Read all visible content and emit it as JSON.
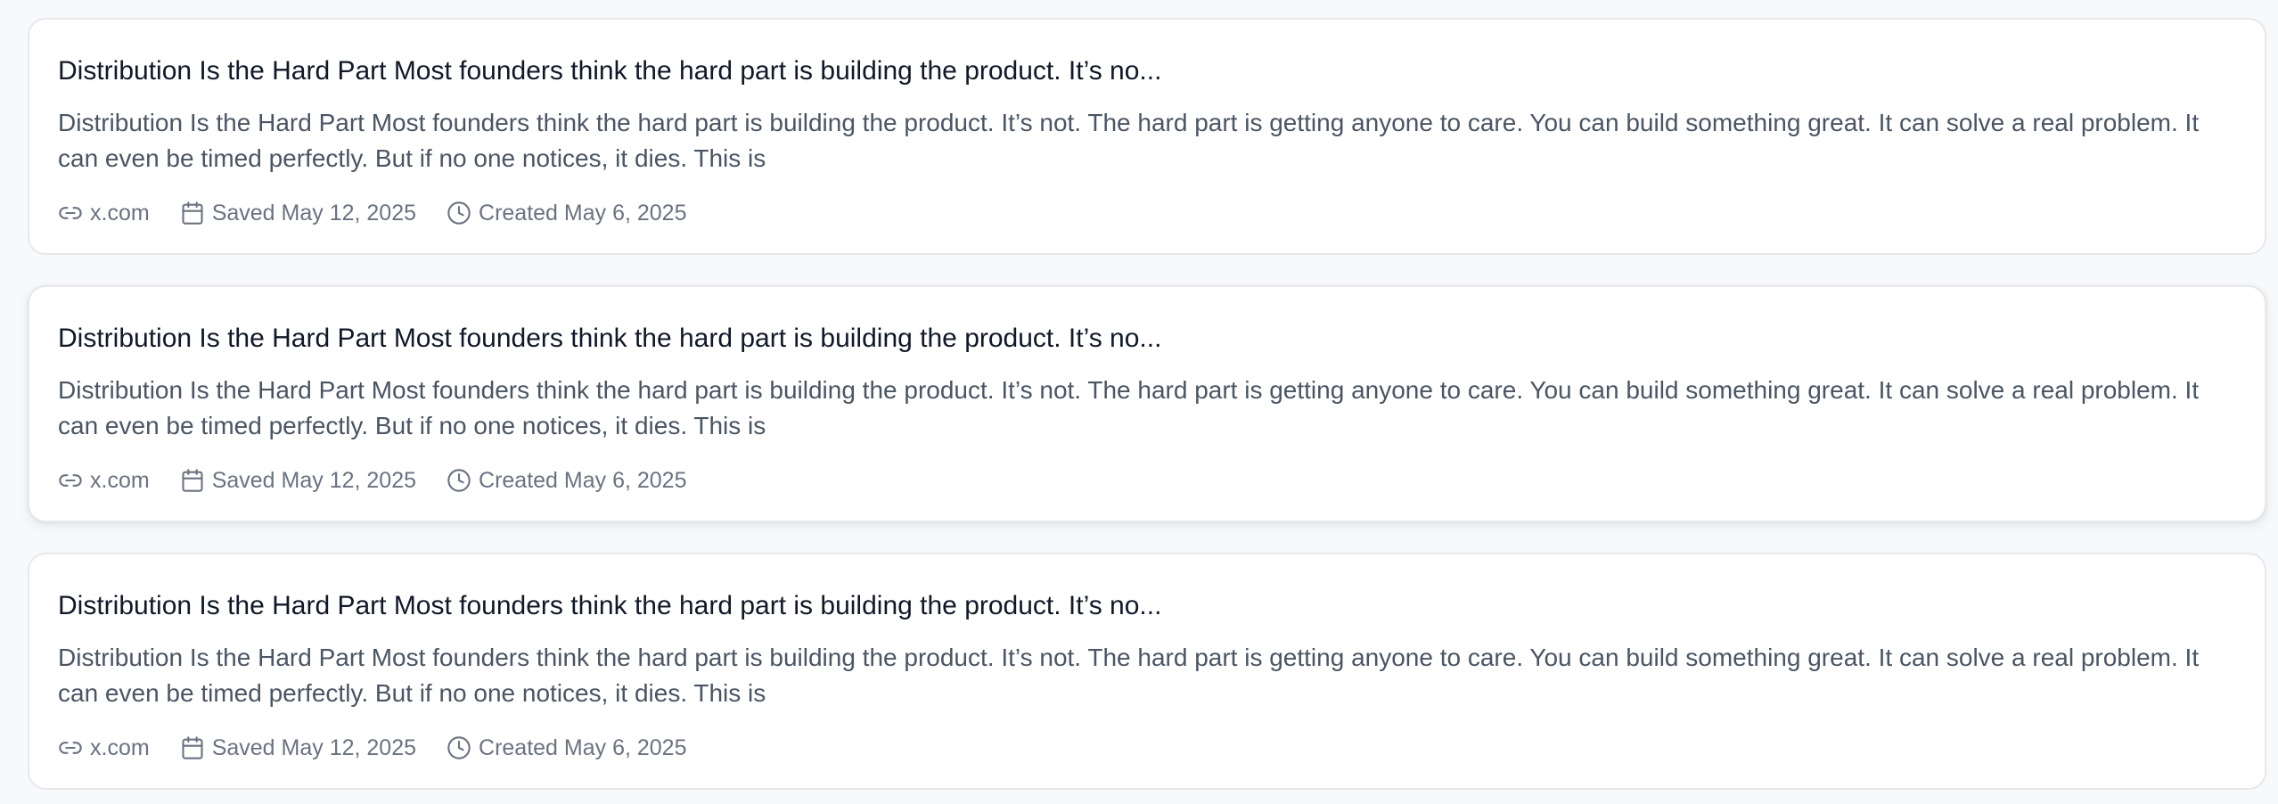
{
  "cards": [
    {
      "title": "Distribution Is the Hard Part Most founders think the hard part is building the product. It’s no...",
      "excerpt": "Distribution Is the Hard Part Most founders think the hard part is building the product. It’s not. The hard part is getting anyone to care. You can build something great. It can solve a real problem. It can even be timed perfectly. But if no one notices, it dies. This is",
      "source": "x.com",
      "saved": "Saved May 12, 2025",
      "created": "Created May 6, 2025"
    },
    {
      "title": "Distribution Is the Hard Part Most founders think the hard part is building the product. It’s no...",
      "excerpt": "Distribution Is the Hard Part Most founders think the hard part is building the product. It’s not. The hard part is getting anyone to care. You can build something great. It can solve a real problem. It can even be timed perfectly. But if no one notices, it dies. This is",
      "source": "x.com",
      "saved": "Saved May 12, 2025",
      "created": "Created May 6, 2025"
    },
    {
      "title": "Distribution Is the Hard Part Most founders think the hard part is building the product. It’s no...",
      "excerpt": "Distribution Is the Hard Part Most founders think the hard part is building the product. It’s not. The hard part is getting anyone to care. You can build something great. It can solve a real problem. It can even be timed perfectly. But if no one notices, it dies. This is",
      "source": "x.com",
      "saved": "Saved May 12, 2025",
      "created": "Created May 6, 2025"
    }
  ],
  "icons": {
    "source": "link-icon",
    "saved": "calendar-icon",
    "created": "clock-icon"
  },
  "colors": {
    "background": "#f8f9fb",
    "card_border": "#e6e8ec",
    "title": "#111827",
    "excerpt": "#4b5563",
    "meta": "#6b7280"
  }
}
